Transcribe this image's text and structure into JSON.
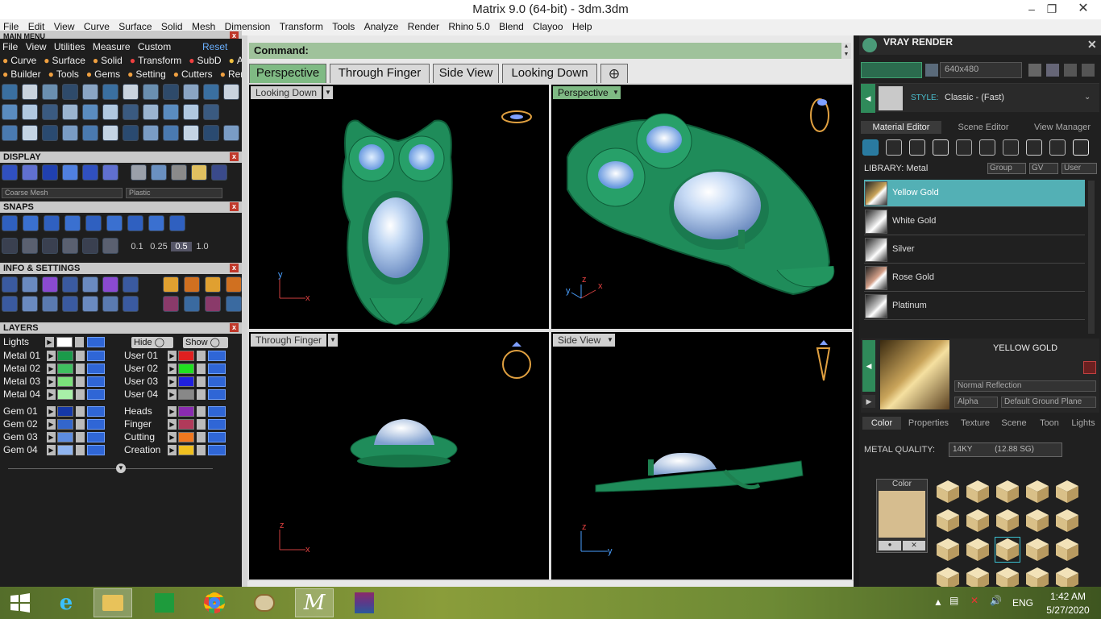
{
  "window": {
    "title": "Matrix 9.0 (64-bit) - 3dm.3dm"
  },
  "menubar": [
    "File",
    "Edit",
    "View",
    "Curve",
    "Surface",
    "Solid",
    "Mesh",
    "Dimension",
    "Transform",
    "Tools",
    "Analyze",
    "Render",
    "Rhino 5.0",
    "Blend",
    "Clayoo",
    "Help"
  ],
  "left": {
    "main_menu_title": "MAIN MENU",
    "main_menu_row1": [
      "File",
      "View",
      "Utilities",
      "Measure",
      "Custom"
    ],
    "reset": "Reset",
    "main_menu_row2": [
      "Curve",
      "Surface",
      "Solid",
      "Transform",
      "SubD",
      "Art"
    ],
    "main_menu_row3": [
      "Builder",
      "Tools",
      "Gems",
      "Setting",
      "Cutters",
      "Render"
    ],
    "display": {
      "title": "DISPLAY",
      "mesh": "Coarse Mesh",
      "material": "Plastic"
    },
    "snaps": {
      "title": "SNAPS",
      "values": [
        "0.1",
        "0.25",
        "0.5",
        "1.0"
      ]
    },
    "info": {
      "title": "INFO & SETTINGS"
    },
    "layers": {
      "title": "LAYERS",
      "lights": "Lights",
      "hide": "Hide",
      "show": "Show",
      "left_col": [
        {
          "name": "Metal 01",
          "color": "#1a9a4a"
        },
        {
          "name": "Metal 02",
          "color": "#3fbf5f"
        },
        {
          "name": "Metal 03",
          "color": "#7be07b"
        },
        {
          "name": "Metal 04",
          "color": "#a8f0a8"
        },
        {
          "name": "Gem 01",
          "color": "#1538a8"
        },
        {
          "name": "Gem 02",
          "color": "#3366cc"
        },
        {
          "name": "Gem 03",
          "color": "#5d8ce0"
        },
        {
          "name": "Gem 04",
          "color": "#8fb4ef"
        }
      ],
      "right_col": [
        {
          "name": "User 01",
          "color": "#e02020"
        },
        {
          "name": "User 02",
          "color": "#20e020"
        },
        {
          "name": "User 03",
          "color": "#2020e0"
        },
        {
          "name": "User 04",
          "color": "#888888"
        },
        {
          "name": "Heads",
          "color": "#8a2bb0"
        },
        {
          "name": "Finger",
          "color": "#b03a5a"
        },
        {
          "name": "Cutting",
          "color": "#f07820"
        },
        {
          "name": "Creation",
          "color": "#f0c020"
        }
      ]
    }
  },
  "command": {
    "label": "Command:"
  },
  "tabs": [
    "Perspective",
    "Through Finger",
    "Side View",
    "Looking Down"
  ],
  "viewports": {
    "tl": {
      "label": "Looking Down",
      "axes": [
        "y",
        "x"
      ]
    },
    "tr": {
      "label": "Perspective",
      "axes": [
        "z",
        "y",
        "x"
      ]
    },
    "bl": {
      "label": "Through Finger",
      "axes": [
        "z",
        "x"
      ]
    },
    "br": {
      "label": "Side View",
      "axes": [
        "z",
        "y"
      ]
    }
  },
  "right": {
    "title": "VRAY RENDER",
    "resolution": "640x480",
    "style_label": "STYLE:",
    "style_value": "Classic - (Fast)",
    "tabs": [
      "Material Editor",
      "Scene Editor",
      "View Manager"
    ],
    "library_label": "LIBRARY: Metal",
    "filters": [
      "Group",
      "GV",
      "User"
    ],
    "materials": [
      {
        "name": "Yellow Gold",
        "color": "#c9a45a",
        "selected": true
      },
      {
        "name": "White Gold",
        "color": "#d8d8d8",
        "selected": false
      },
      {
        "name": "Silver",
        "color": "#cfcfcf",
        "selected": false
      },
      {
        "name": "Rose Gold",
        "color": "#d4a08a",
        "selected": false
      },
      {
        "name": "Platinum",
        "color": "#c4c4c4",
        "selected": false
      }
    ],
    "selected_name": "YELLOW GOLD",
    "reflection": "Normal Reflection",
    "alpha": "Alpha",
    "ground": "Default Ground Plane",
    "sub_tabs": [
      "Color",
      "Properties",
      "Texture",
      "Scene",
      "Toon",
      "Lights"
    ],
    "metal_quality_label": "METAL QUALITY:",
    "metal_quality_value": "14KY          (12.88 SG)",
    "color_label": "Color",
    "color_swatch": "#d6bd8f"
  },
  "taskbar": {
    "time": "1:42 AM",
    "date": "5/27/2020",
    "lang": "ENG"
  }
}
